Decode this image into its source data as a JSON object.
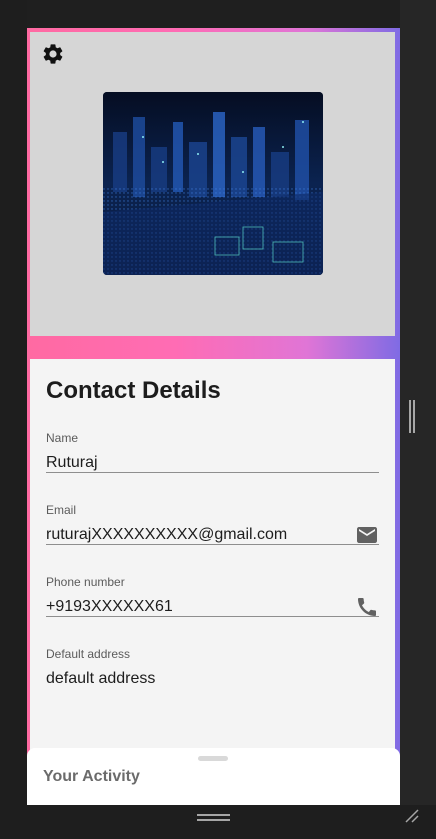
{
  "header": {
    "settings_icon": "gear-icon",
    "hero_image": "digital-city-image"
  },
  "contact": {
    "title": "Contact Details",
    "fields": [
      {
        "label": "Name",
        "value": "Ruturaj",
        "icon": ""
      },
      {
        "label": "Email",
        "value": "ruturajXXXXXXXXXX@gmail.com",
        "icon": "email-icon"
      },
      {
        "label": "Phone number",
        "value": "+9193XXXXXX61",
        "icon": "phone-icon"
      },
      {
        "label": "Default address",
        "value": "default address",
        "icon": ""
      }
    ]
  },
  "sheet": {
    "title": "Your Activity"
  },
  "colors": {
    "gradient_start": "#ff6aa2",
    "gradient_end": "#7f6be4",
    "header_bg": "#d6d6d6",
    "card_bg": "#f4f4f4"
  }
}
